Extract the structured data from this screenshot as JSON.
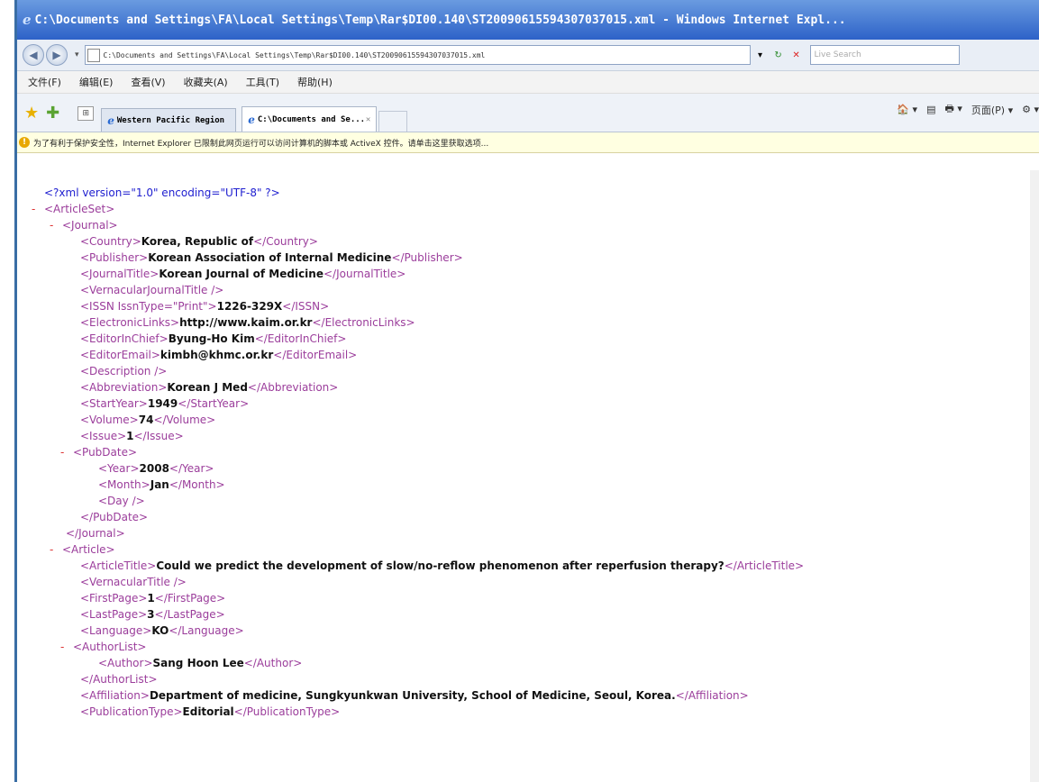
{
  "window": {
    "ie_glyph": "e",
    "title": "C:\\Documents and Settings\\FA\\Local Settings\\Temp\\Rar$DI00.140\\ST20090615594307037015.xml - Windows Internet Expl..."
  },
  "addressbar": {
    "back_glyph": "◀",
    "forward_glyph": "▶",
    "dropdown_glyph": "▾",
    "url": "C:\\Documents and Settings\\FA\\Local Settings\\Temp\\Rar$DI00.140\\ST20090615594307037015.xml",
    "refresh_glyph": "↻",
    "stop_glyph": "✕",
    "search_placeholder": "Live Search"
  },
  "menu": [
    "文件(F)",
    "编辑(E)",
    "查看(V)",
    "收藏夹(A)",
    "工具(T)",
    "帮助(H)"
  ],
  "tabs": {
    "star_glyph": "★",
    "add_glyph": "✚",
    "grid_glyph": "⊞",
    "tab1": "Western Pacific Region",
    "tab2": "C:\\Documents and Se...",
    "tab2_close": "✕",
    "commands": [
      "🏠 ▾",
      "▤",
      "🖶 ▾",
      "页面(P) ▾",
      "⚙ ▾"
    ]
  },
  "infobar": {
    "icon": "!",
    "text": "为了有利于保护安全性，Internet Explorer 已限制此网页运行可以访问计算机的脚本或 ActiveX 控件。请单击这里获取选项..."
  },
  "xml": {
    "decl": "<?xml version=\"1.0\" encoding=\"UTF-8\" ?>",
    "lines": [
      {
        "indent": 0,
        "minus": false,
        "open": "<?xml version=\"1.0\" encoding=\"UTF-8\" ?>",
        "value": "",
        "close": "",
        "pi": true
      },
      {
        "indent": 0,
        "minus": true,
        "open": "<ArticleSet>",
        "value": "",
        "close": ""
      },
      {
        "indent": 1,
        "minus": true,
        "open": "<Journal>",
        "value": "",
        "close": ""
      },
      {
        "indent": 2,
        "minus": false,
        "open": "<Country>",
        "value": "Korea, Republic of",
        "close": "</Country>"
      },
      {
        "indent": 2,
        "minus": false,
        "open": "<Publisher>",
        "value": "Korean Association of Internal Medicine",
        "close": "</Publisher>"
      },
      {
        "indent": 2,
        "minus": false,
        "open": "<JournalTitle>",
        "value": "Korean Journal of Medicine",
        "close": "</JournalTitle>"
      },
      {
        "indent": 2,
        "minus": false,
        "open": "<VernacularJournalTitle />",
        "value": "",
        "close": ""
      },
      {
        "indent": 2,
        "minus": false,
        "open": "<ISSN IssnType=\"Print\">",
        "value": "1226-329X",
        "close": "</ISSN>"
      },
      {
        "indent": 2,
        "minus": false,
        "open": "<ElectronicLinks>",
        "value": "http://www.kaim.or.kr",
        "close": "</ElectronicLinks>"
      },
      {
        "indent": 2,
        "minus": false,
        "open": "<EditorInChief>",
        "value": "Byung-Ho Kim",
        "close": "</EditorInChief>"
      },
      {
        "indent": 2,
        "minus": false,
        "open": "<EditorEmail>",
        "value": "kimbh@khmc.or.kr",
        "close": "</EditorEmail>"
      },
      {
        "indent": 2,
        "minus": false,
        "open": "<Description />",
        "value": "",
        "close": ""
      },
      {
        "indent": 2,
        "minus": false,
        "open": "<Abbreviation>",
        "value": "Korean J Med",
        "close": "</Abbreviation>"
      },
      {
        "indent": 2,
        "minus": false,
        "open": "<StartYear>",
        "value": "1949",
        "close": "</StartYear>"
      },
      {
        "indent": 2,
        "minus": false,
        "open": "<Volume>",
        "value": "74",
        "close": "</Volume>"
      },
      {
        "indent": 2,
        "minus": false,
        "open": "<Issue>",
        "value": "1",
        "close": "</Issue>"
      },
      {
        "indent": 1.6,
        "minus": true,
        "open": "<PubDate>",
        "value": "",
        "close": ""
      },
      {
        "indent": 3,
        "minus": false,
        "open": "<Year>",
        "value": "2008",
        "close": "</Year>"
      },
      {
        "indent": 3,
        "minus": false,
        "open": "<Month>",
        "value": "Jan",
        "close": "</Month>"
      },
      {
        "indent": 3,
        "minus": false,
        "open": "<Day />",
        "value": "",
        "close": ""
      },
      {
        "indent": 2,
        "minus": false,
        "open": "</PubDate>",
        "value": "",
        "close": ""
      },
      {
        "indent": 1.2,
        "minus": false,
        "open": "</Journal>",
        "value": "",
        "close": ""
      },
      {
        "indent": 1,
        "minus": true,
        "open": "<Article>",
        "value": "",
        "close": ""
      },
      {
        "indent": 2,
        "minus": false,
        "open": "<ArticleTitle>",
        "value": "Could we predict the development of slow/no-reflow phenomenon after reperfusion therapy?",
        "close": "</ArticleTitle>"
      },
      {
        "indent": 2,
        "minus": false,
        "open": "<VernacularTitle />",
        "value": "",
        "close": ""
      },
      {
        "indent": 2,
        "minus": false,
        "open": "<FirstPage>",
        "value": "1",
        "close": "</FirstPage>"
      },
      {
        "indent": 2,
        "minus": false,
        "open": "<LastPage>",
        "value": "3",
        "close": "</LastPage>"
      },
      {
        "indent": 2,
        "minus": false,
        "open": "<Language>",
        "value": "KO",
        "close": "</Language>"
      },
      {
        "indent": 1.6,
        "minus": true,
        "open": "<AuthorList>",
        "value": "",
        "close": ""
      },
      {
        "indent": 3,
        "minus": false,
        "open": "<Author>",
        "value": "Sang Hoon Lee",
        "close": "</Author>"
      },
      {
        "indent": 2,
        "minus": false,
        "open": "</AuthorList>",
        "value": "",
        "close": ""
      },
      {
        "indent": 2,
        "minus": false,
        "open": "<Affiliation>",
        "value": "Department of medicine, Sungkyunkwan University, School of Medicine, Seoul, Korea.",
        "close": "</Affiliation>"
      },
      {
        "indent": 2,
        "minus": false,
        "open": "<PublicationType>",
        "value": "Editorial",
        "close": "</PublicationType>"
      }
    ]
  },
  "colors": {
    "tag": "#9b3d9b",
    "pi": "#2020d0",
    "minus": "#dd3333",
    "title_bar": "#2d62c8"
  }
}
